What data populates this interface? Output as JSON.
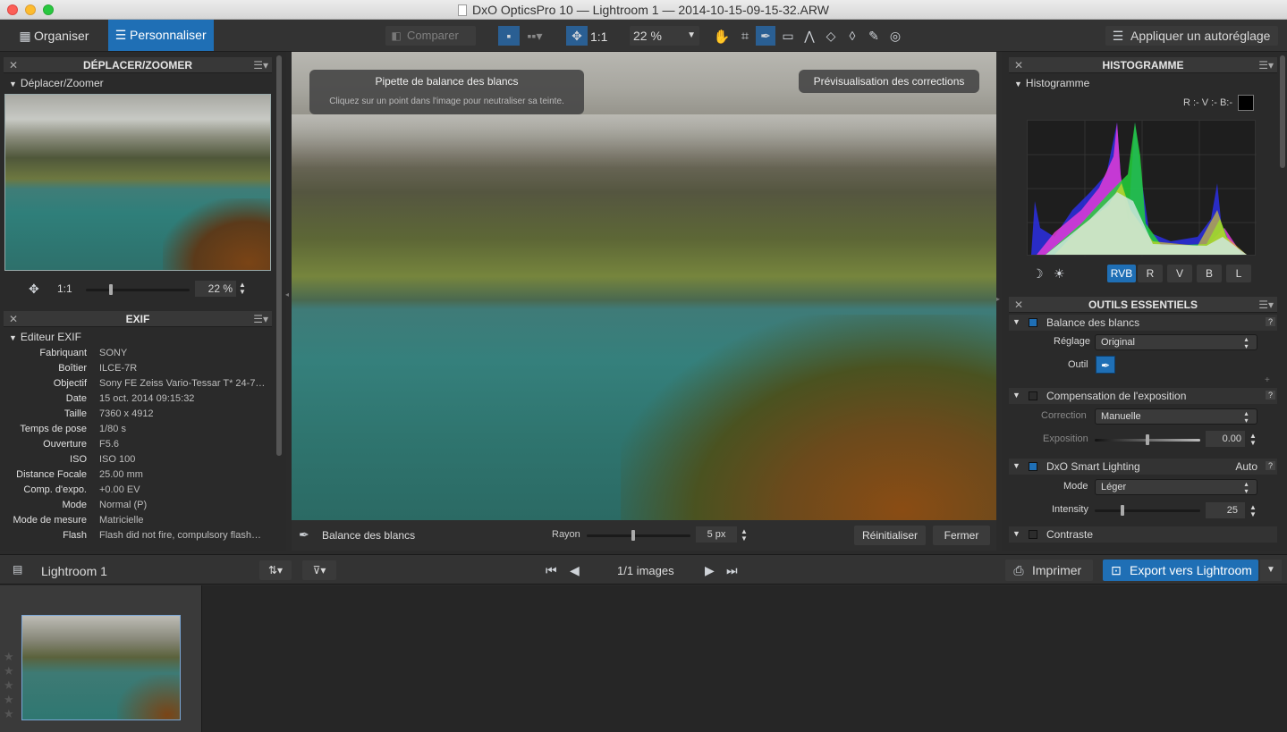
{
  "window": {
    "title": "DxO OpticsPro 10 — Lightroom 1 — 2014-10-15-09-15-32.ARW"
  },
  "toolbar": {
    "organiser": "Organiser",
    "personnaliser": "Personnaliser",
    "comparer": "Comparer",
    "ratio": "1:1",
    "zoom": "22 %",
    "auto_adjust": "Appliquer un autoréglage"
  },
  "left": {
    "nav_title": "DÉPLACER/ZOOMER",
    "nav_sub": "Déplacer/Zoomer",
    "nav_ratio": "1:1",
    "nav_zoom": "22 %",
    "exif_title": "EXIF",
    "exif_sub": "Editeur EXIF",
    "exif": [
      {
        "label": "Fabriquant",
        "value": "SONY"
      },
      {
        "label": "Boîtier",
        "value": "ILCE-7R"
      },
      {
        "label": "Objectif",
        "value": "Sony FE Zeiss Vario-Tessar T* 24-7…"
      },
      {
        "label": "Date",
        "value": "15 oct. 2014 09:15:32"
      },
      {
        "label": "Taille",
        "value": "7360 x 4912"
      },
      {
        "label": "Temps de pose",
        "value": "1/80 s"
      },
      {
        "label": "Ouverture",
        "value": "F5.6"
      },
      {
        "label": "ISO",
        "value": "ISO 100"
      },
      {
        "label": "Distance Focale",
        "value": "25.00 mm"
      },
      {
        "label": "Comp. d'expo.",
        "value": "+0.00 EV"
      },
      {
        "label": "Mode",
        "value": "Normal (P)"
      },
      {
        "label": "Mode de mesure",
        "value": "Matricielle"
      },
      {
        "label": "Flash",
        "value": "Flash did not fire, compulsory flash…"
      }
    ]
  },
  "viewer": {
    "tip_title": "Pipette de balance des blancs",
    "tip_text": "Cliquez sur un point dans l'image pour neutraliser sa teinte.",
    "preview_btn": "Prévisualisation des corrections",
    "bottom_tool": "Balance des blancs",
    "rayon_label": "Rayon",
    "rayon_value": "5 px",
    "reset": "Réinitialiser",
    "close": "Fermer"
  },
  "right": {
    "hist_title": "HISTOGRAMME",
    "hist_sub": "Histogramme",
    "rgb_readout": "R :- V :- B:-",
    "channels": [
      "RVB",
      "R",
      "V",
      "B",
      "L"
    ],
    "tools_title": "OUTILS ESSENTIELS",
    "wb_title": "Balance des blancs",
    "wb_reglage_label": "Réglage",
    "wb_reglage_value": "Original",
    "wb_outil_label": "Outil",
    "exp_title": "Compensation de l'exposition",
    "exp_correction_label": "Correction",
    "exp_correction_value": "Manuelle",
    "exp_exposition_label": "Exposition",
    "exp_exposition_value": "0.00",
    "sl_title": "DxO Smart Lighting",
    "sl_auto": "Auto",
    "sl_mode_label": "Mode",
    "sl_mode_value": "Léger",
    "sl_intensity_label": "Intensity",
    "sl_intensity_value": "25",
    "contrast_title": "Contraste",
    "help": "?"
  },
  "filmstrip": {
    "project": "Lightroom 1",
    "count": "1/1 images",
    "print": "Imprimer",
    "export": "Export vers Lightroom"
  },
  "colors": {
    "accent": "#1f6fb5",
    "active": "#2a5f93"
  }
}
